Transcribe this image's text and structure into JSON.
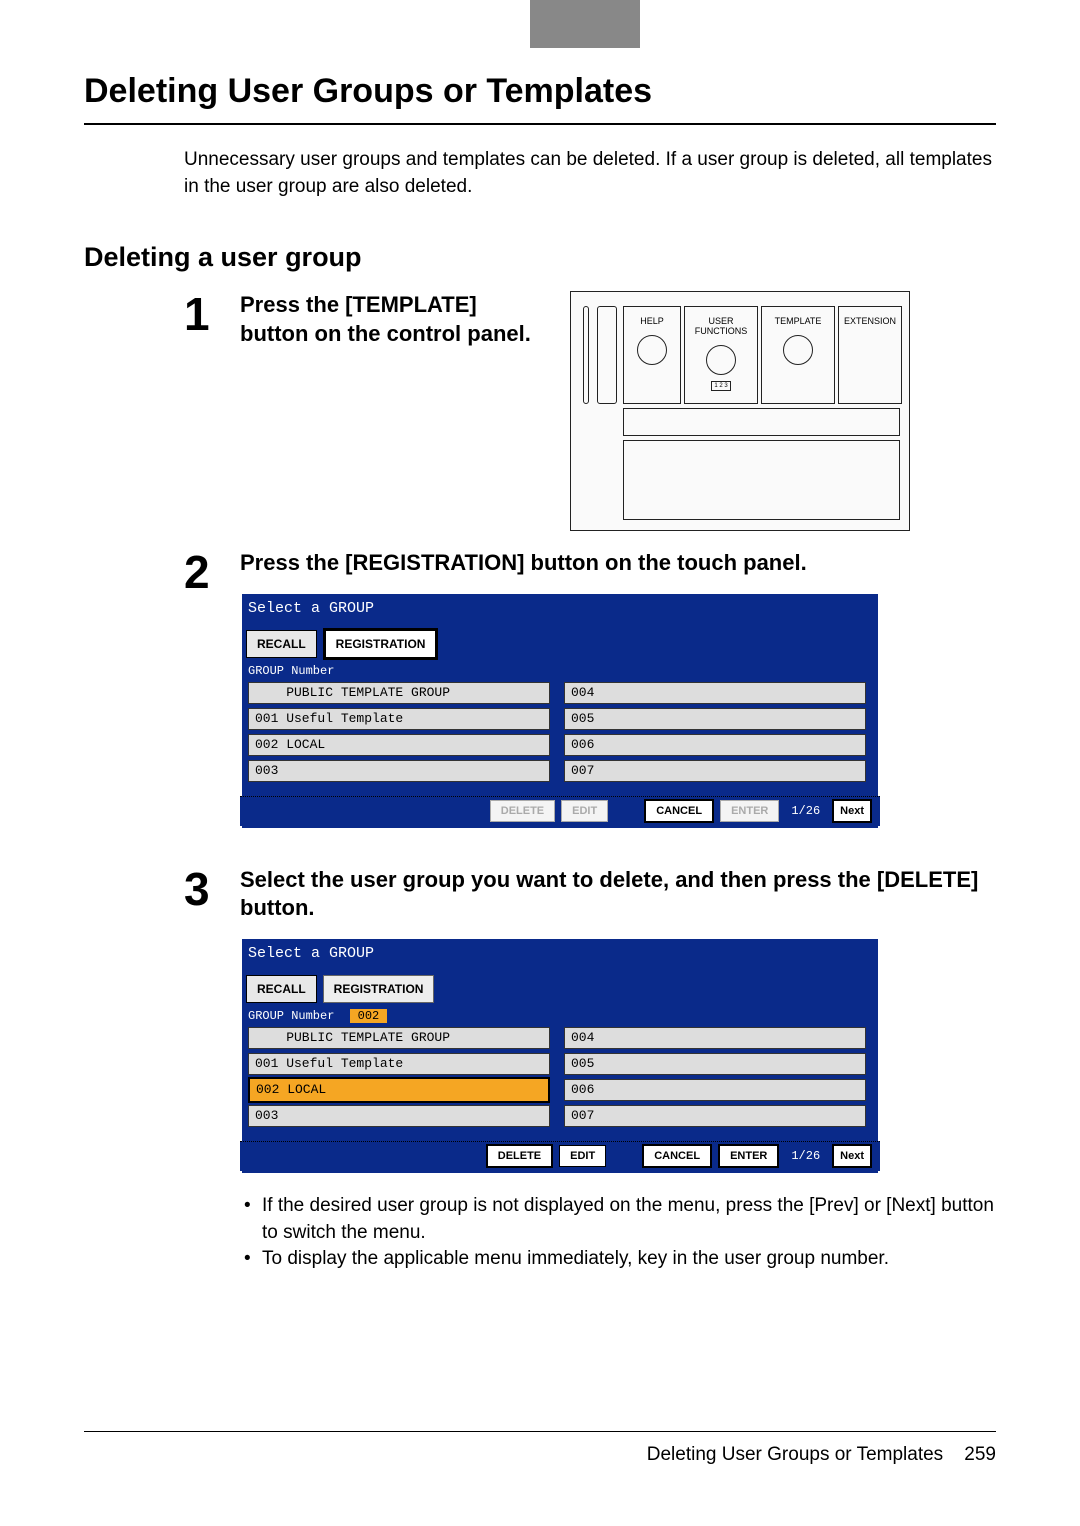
{
  "header_tab_marker": "",
  "title": "Deleting User Groups or Templates",
  "intro": "Unnecessary user groups and templates can be deleted. If a user group is deleted, all templates in the user group are also deleted.",
  "section": "Deleting a user group",
  "step1": {
    "num": "1",
    "text": "Press the [TEMPLATE] button on the control panel.",
    "panel": {
      "help": "HELP",
      "user_functions": "USER\nFUNCTIONS",
      "template": "TEMPLATE",
      "extension": "EXTENSION",
      "small": "1 2 3"
    }
  },
  "step2": {
    "num": "2",
    "text": "Press the [REGISTRATION] button on the touch panel.",
    "screen": {
      "title": "Select a GROUP",
      "tabs": {
        "recall": "RECALL",
        "registration": "REGISTRATION"
      },
      "group_number_label": "GROUP Number",
      "rows_left": [
        "    PUBLIC TEMPLATE GROUP",
        "001 Useful Template",
        "002 LOCAL",
        "003"
      ],
      "rows_right": [
        "004",
        "005",
        "006",
        "007"
      ],
      "buttons": {
        "delete": "DELETE",
        "edit": "EDIT",
        "cancel": "CANCEL",
        "enter": "ENTER",
        "next": "Next"
      },
      "page": "1/26"
    }
  },
  "step3": {
    "num": "3",
    "text": "Select the user group you want to delete, and then press the [DELETE] button.",
    "screen": {
      "title": "Select a GROUP",
      "tabs": {
        "recall": "RECALL",
        "registration": "REGISTRATION"
      },
      "group_number_label": "GROUP Number",
      "group_number_value": "002",
      "rows_left": [
        "    PUBLIC TEMPLATE GROUP",
        "001 Useful Template",
        "002 LOCAL",
        "003"
      ],
      "selected_index": 2,
      "rows_right": [
        "004",
        "005",
        "006",
        "007"
      ],
      "buttons": {
        "delete": "DELETE",
        "edit": "EDIT",
        "cancel": "CANCEL",
        "enter": "ENTER",
        "next": "Next"
      },
      "page": "1/26"
    },
    "bullets": [
      "If the desired user group is not displayed on the menu, press the [Prev] or [Next] button to switch the menu.",
      "To display the applicable menu immediately, key in the user group number."
    ]
  },
  "footer": {
    "text": "Deleting User Groups or Templates",
    "page": "259"
  }
}
